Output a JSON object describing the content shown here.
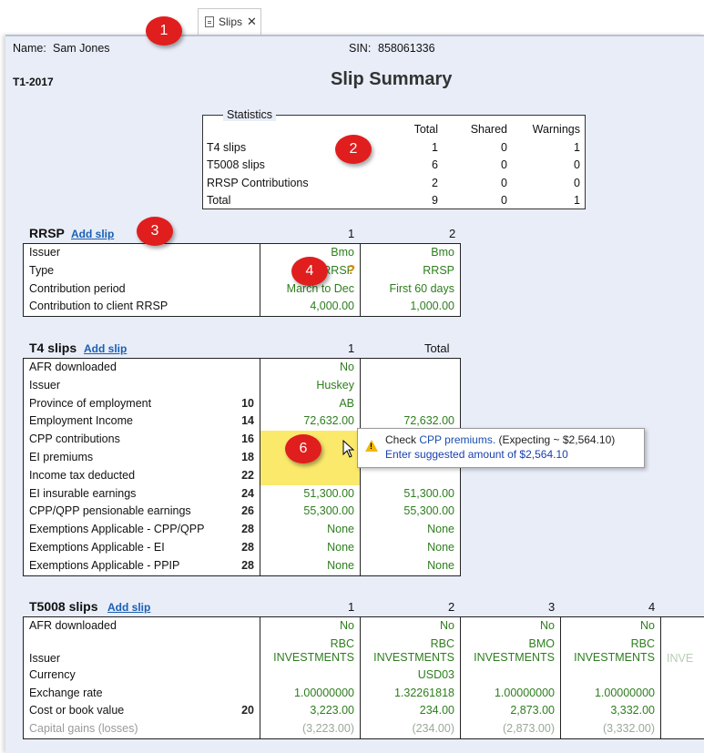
{
  "tab": {
    "label": "Slips",
    "close": "✕"
  },
  "header": {
    "name_label": "Name:",
    "name_value": "Sam Jones",
    "sin_label": "SIN:",
    "sin_value": "858061336",
    "return_year": "T1-2017",
    "title": "Slip Summary"
  },
  "statistics": {
    "legend": "Statistics",
    "columns": [
      "Total",
      "Shared",
      "Warnings"
    ],
    "rows": [
      {
        "label": "T4 slips",
        "total": "1",
        "shared": "0",
        "warnings": "1"
      },
      {
        "label": "T5008 slips",
        "total": "6",
        "shared": "0",
        "warnings": "0"
      },
      {
        "label": "RRSP Contributions",
        "total": "2",
        "shared": "0",
        "warnings": "0"
      },
      {
        "label": "Total",
        "total": "9",
        "shared": "0",
        "warnings": "1"
      }
    ]
  },
  "rrsp": {
    "title": "RRSP",
    "add_link": "Add slip",
    "col_headers": [
      "1",
      "2"
    ],
    "rows": [
      {
        "label": "Issuer",
        "c1": "Bmo",
        "c2": "Bmo"
      },
      {
        "label": "Type",
        "c1": "RRSP",
        "c2": "RRSP"
      },
      {
        "label": "Contribution period",
        "c1": "March to Dec",
        "c2": "First 60 days"
      },
      {
        "label": "Contribution to client RRSP",
        "c1": "4,000.00",
        "c2": "1,000.00"
      }
    ]
  },
  "t4": {
    "title": "T4 slips",
    "add_link": "Add slip",
    "col_headers": [
      "1",
      "Total"
    ],
    "rows": [
      {
        "label": "AFR downloaded",
        "box": "",
        "c1": "No",
        "c2": ""
      },
      {
        "label": "Issuer",
        "box": "",
        "c1": "Huskey",
        "c2": ""
      },
      {
        "label": "Province of employment",
        "box": "10",
        "c1": "AB",
        "c2": ""
      },
      {
        "label": "Employment Income",
        "box": "14",
        "c1": "72,632.00",
        "c2": "72,632.00"
      },
      {
        "label": "CPP contributions",
        "box": "16",
        "c1": "",
        "c2": ""
      },
      {
        "label": "EI premiums",
        "box": "18",
        "c1": "",
        "c2": ""
      },
      {
        "label": "Income tax deducted",
        "box": "22",
        "c1": "",
        "c2": ""
      },
      {
        "label": "EI insurable earnings",
        "box": "24",
        "c1": "51,300.00",
        "c2": "51,300.00"
      },
      {
        "label": "CPP/QPP pensionable earnings",
        "box": "26",
        "c1": "55,300.00",
        "c2": "55,300.00"
      },
      {
        "label": "Exemptions Applicable - CPP/QPP",
        "box": "28",
        "c1": "None",
        "c2": "None"
      },
      {
        "label": "Exemptions Applicable - EI",
        "box": "28",
        "c1": "None",
        "c2": "None"
      },
      {
        "label": "Exemptions Applicable - PPIP",
        "box": "28",
        "c1": "None",
        "c2": "None"
      }
    ]
  },
  "tooltip": {
    "line1_prefix": "Check",
    "line1_link": "CPP premiums.",
    "line1_suffix": "(Expecting ~ $2,564.10)",
    "line2": "Enter suggested amount of $2,564.10"
  },
  "t5008": {
    "title": "T5008 slips",
    "add_link": "Add slip",
    "col_headers": [
      "1",
      "2",
      "3",
      "4"
    ],
    "rows": [
      {
        "label": "AFR downloaded",
        "box": "",
        "c": [
          "No",
          "No",
          "No",
          "No"
        ]
      },
      {
        "label": "Issuer",
        "box": "",
        "c": [
          "RBC\nINVESTMENTS",
          "RBC\nINVESTMENTS",
          "BMO\nINVESTMENTS",
          "RBC\nINVESTMENTS"
        ]
      },
      {
        "label": "Currency",
        "box": "",
        "c": [
          "",
          "USD03",
          "",
          ""
        ]
      },
      {
        "label": "Exchange rate",
        "box": "",
        "c": [
          "1.00000000",
          "1.32261818",
          "1.00000000",
          "1.00000000"
        ]
      },
      {
        "label": "Cost or book value",
        "box": "20",
        "c": [
          "3,223.00",
          "234.00",
          "2,873.00",
          "3,332.00"
        ]
      },
      {
        "label": "Capital gains (losses)",
        "box": "",
        "c": [
          "(3,223.00)",
          "(234.00)",
          "(2,873.00)",
          "(3,332.00)"
        ]
      }
    ],
    "partial_col_text": "INVE"
  },
  "callouts": [
    "1",
    "2",
    "3",
    "4",
    "6"
  ],
  "colors": {
    "value_green": "#2e7d1e",
    "link_blue": "#1a5fb4",
    "callout_red": "#e01e1e",
    "highlight_yellow": "#fbe96c"
  }
}
